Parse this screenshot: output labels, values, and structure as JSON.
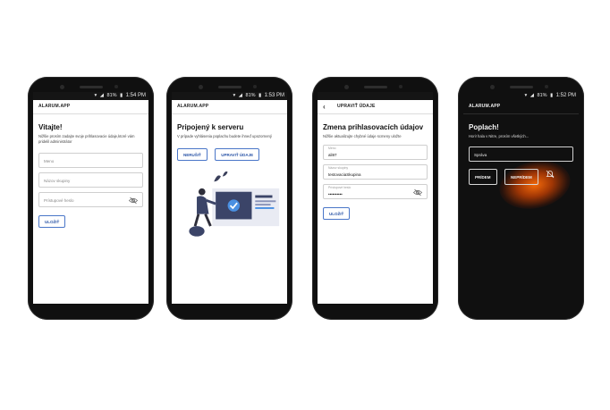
{
  "status": {
    "p1": {
      "battery": "81%",
      "time": "1:54 PM"
    },
    "p2": {
      "battery": "81%",
      "time": "1:53 PM"
    },
    "p3": {
      "battery": "",
      "time": ""
    },
    "p4": {
      "battery": "81%",
      "time": "1:52 PM"
    }
  },
  "screen1": {
    "appbar": "ALARUM.APP",
    "title": "Vitajte!",
    "subtitle": "Nižšie prosím zadajte svoje prihlasovacie údaje,ktoré vám pridelil administrátor",
    "name_placeholder": "Meno",
    "group_placeholder": "Názov skupiny",
    "password_placeholder": "Prístupové heslo",
    "save_button": "ULOŽIŤ"
  },
  "screen2": {
    "appbar": "ALARUM.APP",
    "title": "Pripojený k serveru",
    "subtitle": "V prípade vyhlásenia poplachu budete ihneď upozornený",
    "cancel_button": "NERUŠIŤ",
    "edit_button": "UPRAVIŤ ÚDAJE"
  },
  "screen3": {
    "appbar": "UPRAVIŤ ÚDAJE",
    "title": "Zmena prihlasovacích údajov",
    "subtitle": "Nižšie aktualizujte chybné údaje scmeny uložte",
    "name_label": "Meno",
    "name_value": "ali97",
    "group_label": "Názov skupiny",
    "group_value": "testovaciaSkupina",
    "password_label": "Prístupové heslo",
    "password_value": "••••••••••",
    "save_button": "ULOŽIŤ"
  },
  "screen4": {
    "appbar": "ALARUM.APP",
    "title": "Poplach!",
    "subtitle": "Hori! hala v Nitre, prosím všetkých...",
    "message_placeholder": "Správa",
    "come_button": "PRÍDEM",
    "not_come_button": "NEPRÍDEM"
  },
  "colors": {
    "accent": "#2c56a8",
    "alert_glow": "#ff6e0a",
    "dark_bg": "#101010"
  },
  "icons": [
    "eye-off-icon",
    "wifi-icon",
    "signal-icon",
    "battery-icon",
    "back-arrow-icon",
    "mute-bell-icon"
  ]
}
